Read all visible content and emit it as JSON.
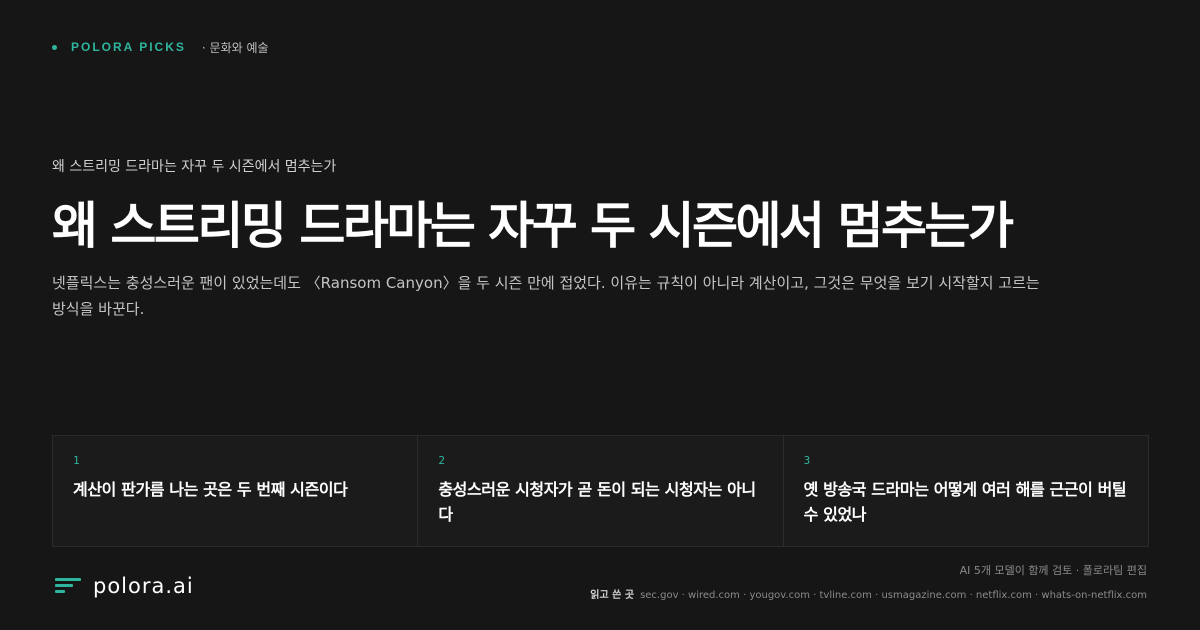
{
  "topbar": {
    "brand": "POLORA PICKS",
    "section": "· 문화와 예술"
  },
  "article": {
    "kicker": "왜 스트리밍 드라마는 자꾸 두 시즌에서 멈추는가",
    "headline": "왜 스트리밍 드라마는 자꾸 두 시즌에서 멈추는가",
    "dek": "넷플릭스는 충성스러운 팬이 있었는데도 〈Ransom Canyon〉을 두 시즌 만에 접었다. 이유는 규칙이 아니라 계산이고, 그것은 무엇을 보기 시작할지 고르는 방식을 바꾼다."
  },
  "cards": [
    {
      "num": "1",
      "title": "계산이 판가름 나는 곳은 두 번째 시즌이다"
    },
    {
      "num": "2",
      "title": "충성스러운 시청자가 곧 돈이 되는 시청자는 아니다"
    },
    {
      "num": "3",
      "title": "옛 방송국 드라마는 어떻게 여러 해를 근근이 버틸 수 있었나"
    }
  ],
  "footer": {
    "logo_text": "polora.ai",
    "review_note": "AI 5개 모델이 함께 검토 · 폴로라팀 편집",
    "sources_label": "읽고 쓴 곳",
    "sources": "sec.gov · wired.com · yougov.com · tvline.com · usmagazine.com · netflix.com · whats-on-netflix.com"
  },
  "colors": {
    "background": "#161616",
    "accent": "#2fb59d"
  }
}
